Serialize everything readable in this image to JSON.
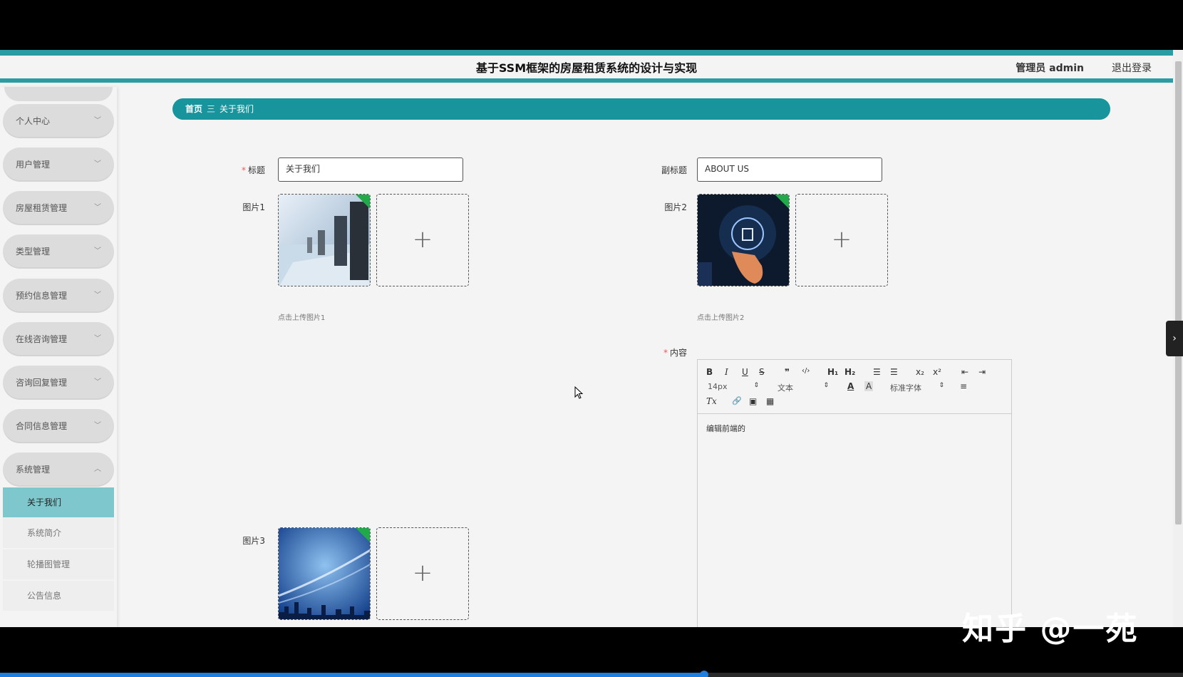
{
  "header": {
    "title": "基于SSM框架的房屋租赁系统的设计与实现",
    "admin_label": "管理员 admin",
    "logout_label": "退出登录"
  },
  "sidebar": {
    "items": [
      {
        "label": "个人中心"
      },
      {
        "label": "用户管理"
      },
      {
        "label": "房屋租赁管理"
      },
      {
        "label": "类型管理"
      },
      {
        "label": "预约信息管理"
      },
      {
        "label": "在线咨询管理"
      },
      {
        "label": "咨询回复管理"
      },
      {
        "label": "合同信息管理"
      },
      {
        "label": "系统管理"
      }
    ],
    "submenu": [
      {
        "label": "关于我们"
      },
      {
        "label": "系统简介"
      },
      {
        "label": "轮播图管理"
      },
      {
        "label": "公告信息"
      }
    ]
  },
  "breadcrumb": {
    "home": "首页",
    "separator": "三",
    "current": "关于我们"
  },
  "form": {
    "title_label": "标题",
    "title_value": "关于我们",
    "subtitle_label": "副标题",
    "subtitle_value": "ABOUT US",
    "image1_label": "图片1",
    "image1_hint": "点击上传图片1",
    "image2_label": "图片2",
    "image2_hint": "点击上传图片2",
    "image3_label": "图片3",
    "content_label": "内容",
    "required_mark": "*",
    "add_symbol": "+"
  },
  "editor": {
    "buttons": {
      "bold": "B",
      "italic": "I",
      "underline": "U",
      "strike": "S",
      "quote": "❞",
      "code": "‹/›",
      "h1": "H₁",
      "h2": "H₂",
      "ordered_list": "☰",
      "bullet_list": "☰",
      "subscript": "x₂",
      "superscript": "x²",
      "outdent": "⇤",
      "indent": "⇥",
      "font_color": "A",
      "bg_color": "A",
      "align": "≡",
      "clean": "Tx",
      "link": "🔗",
      "image": "▣",
      "video": "▦"
    },
    "size_value": "14px",
    "header_value": "文本",
    "font_value": "标准字体",
    "body_text": "编辑前端的"
  },
  "overlay": {
    "watermark": "知乎 @一苑",
    "toggle_symbol": "›"
  },
  "video_progress": 0.595,
  "colors": {
    "accent": "#2c9ca3",
    "breadcrumb_bg": "#17949c",
    "submenu_active": "#7ec8cd",
    "badge_green": "#22aa4a"
  }
}
